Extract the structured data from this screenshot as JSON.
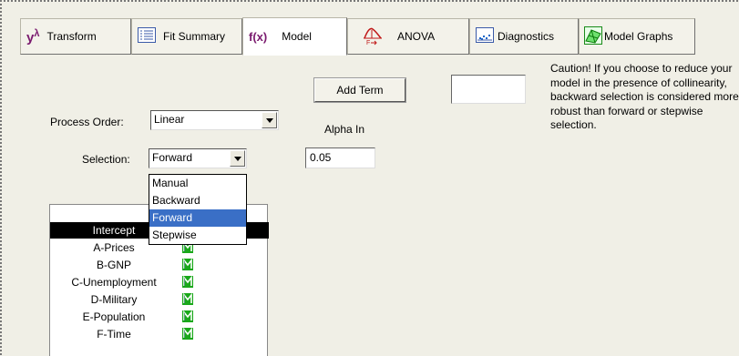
{
  "toolbar": {
    "tabs": [
      {
        "label": "Transform",
        "icon_glyph": "y",
        "icon_sup": "λ",
        "icon": "y-lambda-icon"
      },
      {
        "label": "Fit Summary",
        "icon": "list-icon"
      },
      {
        "label": "Model",
        "icon_text": "f(x)",
        "icon": "fx-icon"
      },
      {
        "label": "ANOVA",
        "icon": "f-distribution-icon"
      },
      {
        "label": "Diagnostics",
        "icon": "scatter-icon"
      },
      {
        "label": "Model Graphs",
        "icon": "surface-icon"
      }
    ],
    "active_tab": "Model"
  },
  "form": {
    "add_term_label": "Add Term",
    "add_term_value": "",
    "process_order_label": "Process Order:",
    "process_order_value": "Linear",
    "alpha_in_label": "Alpha In",
    "alpha_in_value": "0.05",
    "selection_label": "Selection:",
    "selection_value": "Forward",
    "selection_options": [
      "Manual",
      "Backward",
      "Forward",
      "Stepwise"
    ],
    "selection_highlighted": "Forward"
  },
  "caution_text": "Caution!  If you choose to reduce your model in the presence of collinearity, backward selection is considered more robust than forward or stepwise selection.",
  "terms": {
    "header": "Intercept",
    "items": [
      {
        "name": "A-Prices",
        "mark": "M"
      },
      {
        "name": "B-GNP",
        "mark": "M"
      },
      {
        "name": "C-Unemployment",
        "mark": "M"
      },
      {
        "name": "D-Military",
        "mark": "M"
      },
      {
        "name": "E-Population",
        "mark": "M"
      },
      {
        "name": "F-Time",
        "mark": "M"
      }
    ]
  },
  "colors": {
    "mark_green": "#1aa81a",
    "selection_blue": "#3a6fc6",
    "accent_purple": "#7a1a6e"
  }
}
